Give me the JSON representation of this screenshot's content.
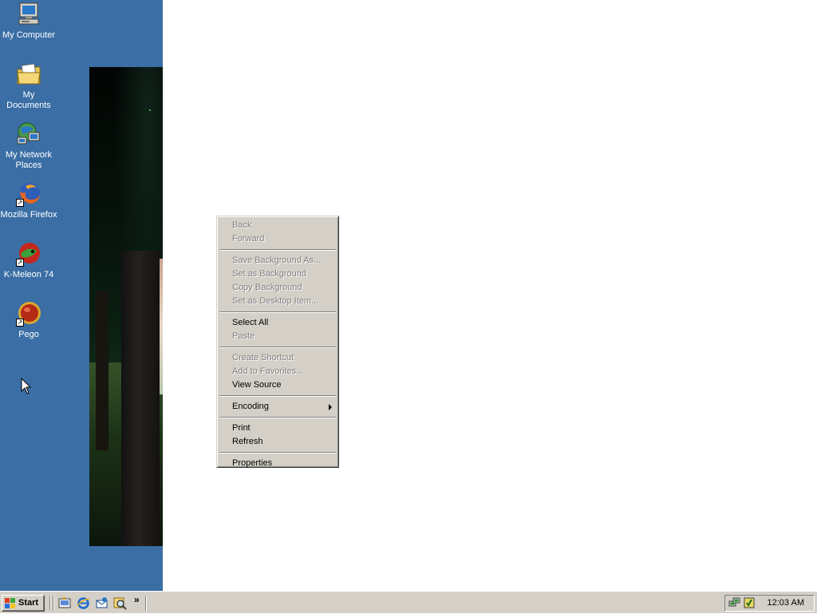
{
  "desktop": {
    "icons": [
      {
        "label": "My Computer",
        "icon": "my-computer-icon"
      },
      {
        "label": "My Documents",
        "icon": "my-documents-icon"
      },
      {
        "label": "My Network Places",
        "icon": "my-network-places-icon"
      },
      {
        "label": "Mozilla Firefox",
        "icon": "firefox-icon"
      },
      {
        "label": "K-Meleon 74",
        "icon": "k-meleon-icon"
      },
      {
        "label": "Pego",
        "icon": "pego-icon"
      }
    ],
    "background_color": "#3a6ea5"
  },
  "context_menu": {
    "items": [
      {
        "label": "Back",
        "enabled": false
      },
      {
        "label": "Forward",
        "enabled": false
      },
      {
        "label": "Save Background As...",
        "enabled": false
      },
      {
        "label": "Set as Background",
        "enabled": false
      },
      {
        "label": "Copy Background",
        "enabled": false
      },
      {
        "label": "Set as Desktop Item...",
        "enabled": false
      },
      {
        "label": "Select All",
        "enabled": true
      },
      {
        "label": "Paste",
        "enabled": false
      },
      {
        "label": "Create Shortcut",
        "enabled": false
      },
      {
        "label": "Add to Favorites...",
        "enabled": false
      },
      {
        "label": "View Source",
        "enabled": true
      },
      {
        "label": "Encoding",
        "enabled": true,
        "submenu": true
      },
      {
        "label": "Print",
        "enabled": true
      },
      {
        "label": "Refresh",
        "enabled": true
      },
      {
        "label": "Properties",
        "enabled": true
      }
    ]
  },
  "taskbar": {
    "start_label": "Start",
    "quick_launch": [
      "show-desktop-icon",
      "internet-explorer-icon",
      "outlook-express-icon",
      "search-icon"
    ],
    "quick_launch_more": "»",
    "tray_icons": [
      "network-icon",
      "security-icon"
    ],
    "clock": "12:03 AM"
  }
}
